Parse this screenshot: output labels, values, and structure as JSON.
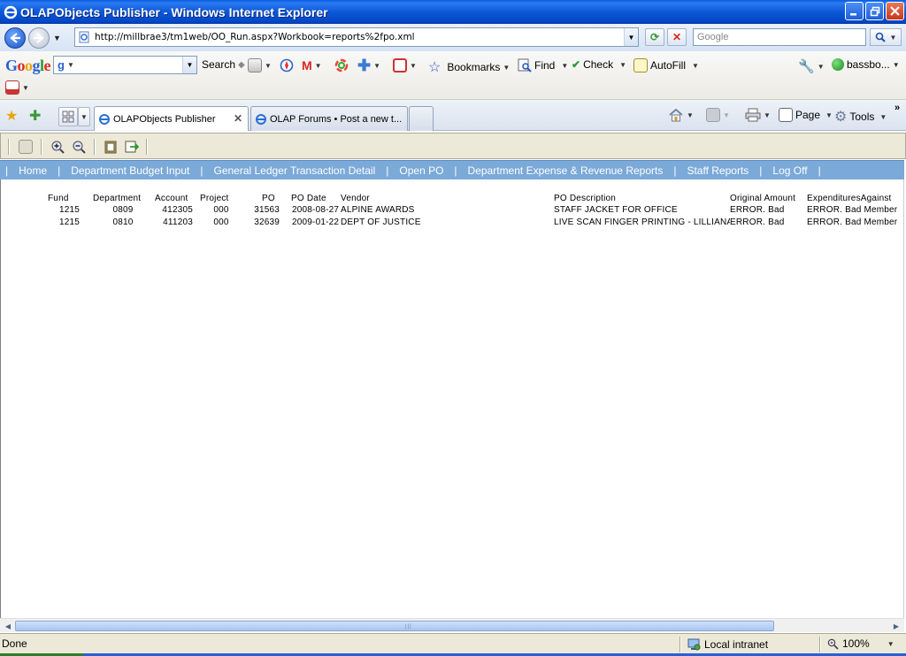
{
  "window": {
    "title": "OLAPObjects Publisher - Windows Internet Explorer"
  },
  "address": {
    "url": "http://millbrae3/tm1web/OO_Run.aspx?Workbook=reports%2fpo.xml",
    "search_placeholder": "Google"
  },
  "google_toolbar": {
    "logo": [
      "G",
      "o",
      "o",
      "g",
      "l",
      "e"
    ],
    "search_value": "g",
    "search_label": "Search",
    "bookmarks_label": "Bookmarks",
    "find_label": "Find",
    "check_label": "Check",
    "autofill_label": "AutoFill",
    "account_label": "bassbo..."
  },
  "tabs": [
    {
      "label": "OLAPObjects Publisher",
      "active": true
    },
    {
      "label": "OLAP Forums • Post a new t...",
      "active": false
    }
  ],
  "command_bar": {
    "page_label": "Page",
    "tools_label": "Tools"
  },
  "nav_menu": {
    "items": [
      "Home",
      "Department Budget Input",
      "General Ledger Transaction Detail",
      "Open PO",
      "Department Expense & Revenue Reports",
      "Staff Reports",
      "Log Off"
    ],
    "bg_color": "#7ba9d8"
  },
  "report": {
    "headers": {
      "fund": "Fund",
      "department": "Department",
      "account": "Account",
      "project": "Project",
      "po": "PO",
      "po_date": "PO Date",
      "vendor": "Vendor",
      "po_description": "PO Description",
      "original_amount": "Original Amount",
      "expenditures": "ExpendituresAgainst"
    },
    "rows": [
      {
        "fund": "1215",
        "department": "0809",
        "account": "412305",
        "project": "000",
        "po": "31563",
        "po_date": "2008-08-27",
        "vendor": "ALPINE AWARDS",
        "po_description": "STAFF JACKET FOR OFFICE",
        "original_amount": "ERROR. Bad",
        "expenditures": "ERROR. Bad Member"
      },
      {
        "fund": "1215",
        "department": "0810",
        "account": "411203",
        "project": "000",
        "po": "32639",
        "po_date": "2009-01-22",
        "vendor": "DEPT OF JUSTICE",
        "po_description": "LIVE SCAN FINGER PRINTING - LILLIANA",
        "original_amount": "ERROR. Bad",
        "expenditures": "ERROR. Bad Member"
      }
    ]
  },
  "status": {
    "left": "Done",
    "zone": "Local intranet",
    "zoom": "100%"
  }
}
